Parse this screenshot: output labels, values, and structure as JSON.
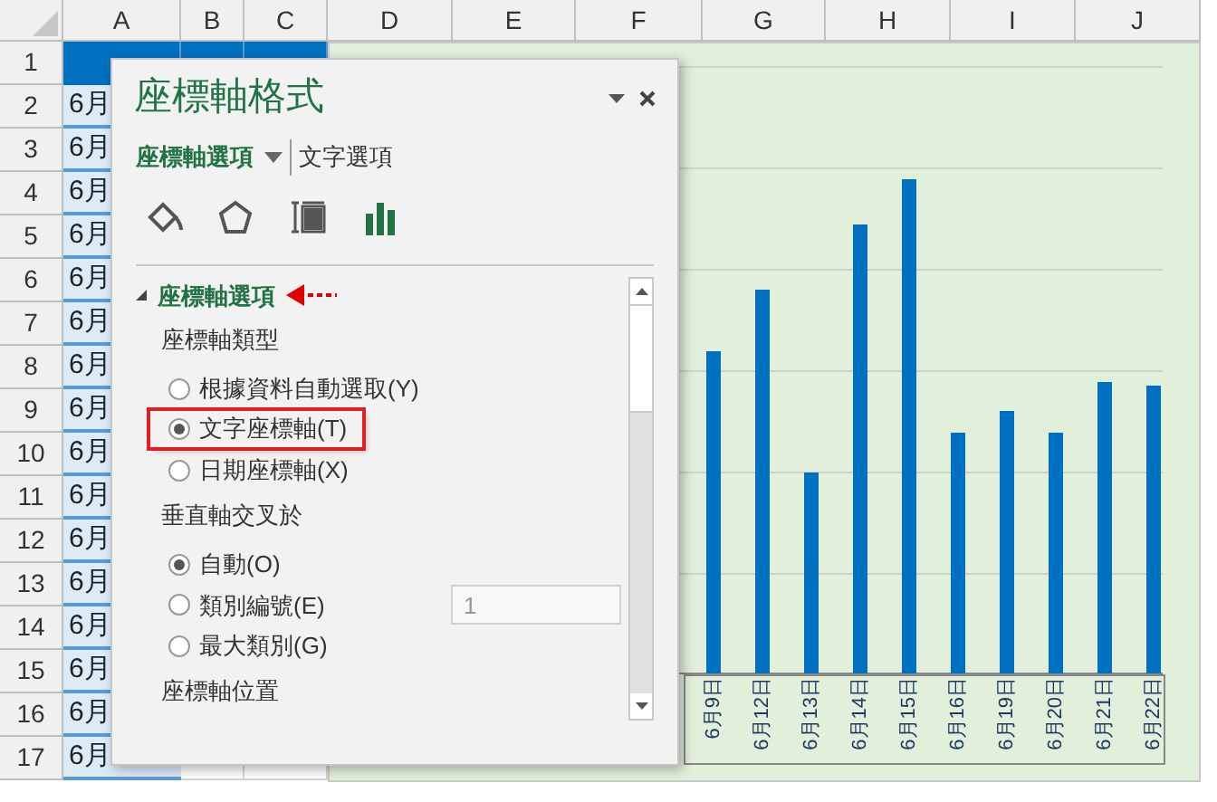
{
  "columns": [
    "A",
    "B",
    "C",
    "D",
    "E",
    "F",
    "G",
    "H",
    "I",
    "J"
  ],
  "rows": [
    "1",
    "2",
    "3",
    "4",
    "5",
    "6",
    "7",
    "8",
    "9",
    "10",
    "11",
    "12",
    "13",
    "14",
    "15",
    "16",
    "17"
  ],
  "column_a": [
    "6月",
    "6月",
    "6月",
    "6月",
    "6月",
    "6月",
    "6月",
    "6月",
    "6月",
    "6月",
    "6月",
    "6月",
    "6月",
    "6月",
    "6月",
    "6月"
  ],
  "chart": {
    "categories": [
      "6月9日",
      "6月12日",
      "6月13日",
      "6月14日",
      "6月15日",
      "6月16日",
      "6月19日",
      "6月20日",
      "6月21日",
      "6月22日"
    ]
  },
  "panel": {
    "title": "座標軸格式",
    "tabs": [
      {
        "label": "座標軸選項",
        "selected": true
      },
      {
        "label": "文字選項",
        "selected": false
      }
    ],
    "icons": [
      {
        "selected": false
      },
      {
        "selected": false
      },
      {
        "selected": false
      },
      {
        "selected": true
      }
    ],
    "section": {
      "title": "座標軸選項",
      "expanded": true,
      "pointer": true,
      "items": [
        {
          "kind": "heading",
          "label": "座標軸類型"
        },
        {
          "kind": "radio",
          "label": "根據資料自動選取(Y)",
          "selected": false,
          "highlighted": false
        },
        {
          "kind": "radio",
          "label": "文字座標軸(T)",
          "selected": true,
          "highlighted": true
        },
        {
          "kind": "radio",
          "label": "日期座標軸(X)",
          "selected": false,
          "highlighted": false
        },
        {
          "kind": "heading",
          "label": "垂直軸交叉於"
        },
        {
          "kind": "radio",
          "label": "自動(O)",
          "selected": true,
          "highlighted": false
        },
        {
          "kind": "radio",
          "label": "類別編號(E)",
          "selected": false,
          "highlighted": false,
          "input": {
            "value": "1",
            "disabled": true
          }
        },
        {
          "kind": "radio",
          "label": "最大類別(G)",
          "selected": false,
          "highlighted": false
        },
        {
          "kind": "heading",
          "label": "座標軸位置"
        }
      ]
    }
  }
}
